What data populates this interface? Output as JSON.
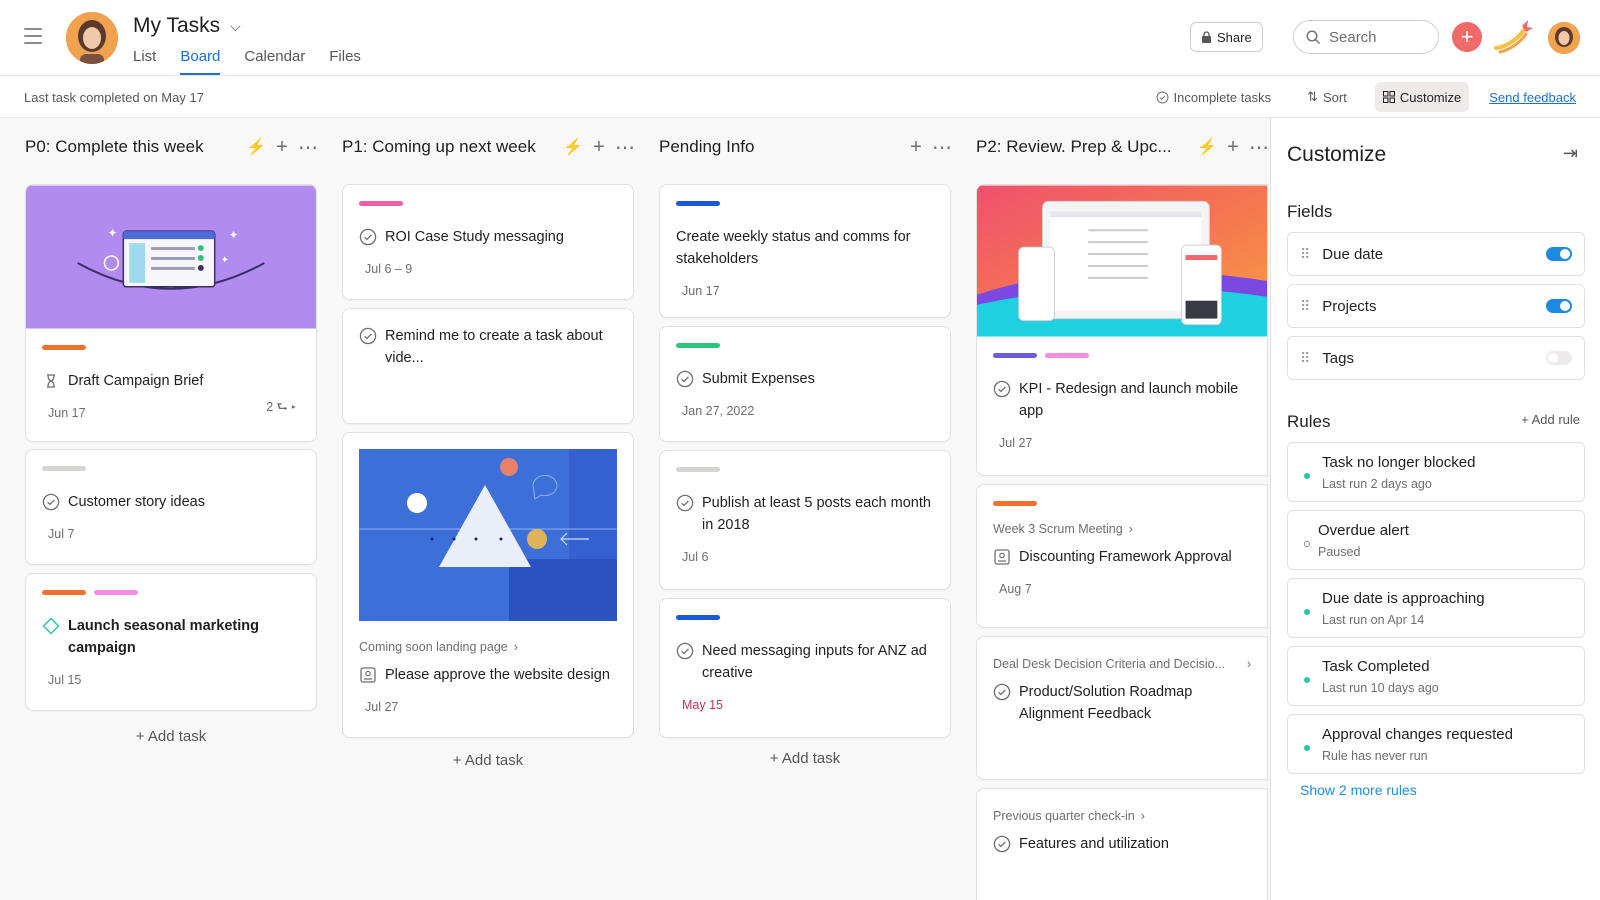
{
  "header": {
    "title": "My Tasks",
    "tabs": [
      "List",
      "Board",
      "Calendar",
      "Files"
    ],
    "share_label": "Share",
    "search_placeholder": "Search"
  },
  "subbar": {
    "last_completed": "Last task completed on May 17",
    "incomplete": "Incomplete tasks",
    "sort": "Sort",
    "customize": "Customize",
    "feedback": "Send feedback"
  },
  "board": {
    "add_task": "+ Add task",
    "columns": [
      {
        "name": "P0: Complete this week",
        "cards": [
          {
            "title": "Draft Campaign Brief",
            "date": "Jun 17",
            "subtasks": "2"
          },
          {
            "title": "Customer story ideas",
            "date": "Jul 7"
          },
          {
            "title": "Launch seasonal marketing campaign",
            "date": "Jul 15"
          }
        ]
      },
      {
        "name": "P1: Coming up next week",
        "cards": [
          {
            "title": "ROI Case Study messaging",
            "date": "Jul 6 – 9"
          },
          {
            "title": "Remind me to create a task about vide..."
          },
          {
            "project": "Coming soon landing page",
            "title": "Please approve the website design",
            "date": "Jul 27"
          }
        ]
      },
      {
        "name": "Pending Info",
        "cards": [
          {
            "title": "Create weekly status and comms for stakeholders",
            "date": "Jun 17"
          },
          {
            "title": "Submit Expenses",
            "date": "Jan 27, 2022"
          },
          {
            "title": "Publish at least 5 posts each month in 2018",
            "date": "Jul 6"
          },
          {
            "title": "Need messaging inputs for ANZ ad creative",
            "date": "May 15"
          }
        ]
      },
      {
        "name": "P2: Review. Prep & Upc...",
        "cards": [
          {
            "title": "KPI - Redesign and launch mobile app",
            "date": "Jul 27"
          },
          {
            "project": "Week 3 Scrum Meeting",
            "title": "Discounting Framework Approval",
            "date": "Aug 7"
          },
          {
            "project": "Deal Desk Decision Criteria and Decisio...",
            "title": "Product/Solution Roadmap Alignment Feedback"
          },
          {
            "project": "Previous quarter check-in",
            "title": "Features and utilization"
          }
        ]
      }
    ]
  },
  "panel": {
    "title": "Customize",
    "fields_title": "Fields",
    "fields": [
      {
        "name": "Due date",
        "on": true
      },
      {
        "name": "Projects",
        "on": true
      },
      {
        "name": "Tags",
        "on": false
      }
    ],
    "rules_title": "Rules",
    "add_rule": "+ Add rule",
    "rules": [
      {
        "name": "Task no longer blocked",
        "sub": "Last run 2 days ago"
      },
      {
        "name": "Overdue alert",
        "sub": "Paused"
      },
      {
        "name": "Due date is approaching",
        "sub": "Last run on Apr 14"
      },
      {
        "name": "Task Completed",
        "sub": "Last run 10 days ago"
      },
      {
        "name": "Approval changes requested",
        "sub": "Rule has never run"
      }
    ],
    "more_rules": "Show 2 more rules"
  },
  "colors": {
    "accent": "#1f6fd3",
    "orange": "#f3712e",
    "pink": "#ee5fa6",
    "lightpink": "#f48fe0",
    "blue": "#1c57d8",
    "green": "#2ec37a",
    "gray": "#d6d4d3",
    "purple": "#6b5cd8"
  }
}
